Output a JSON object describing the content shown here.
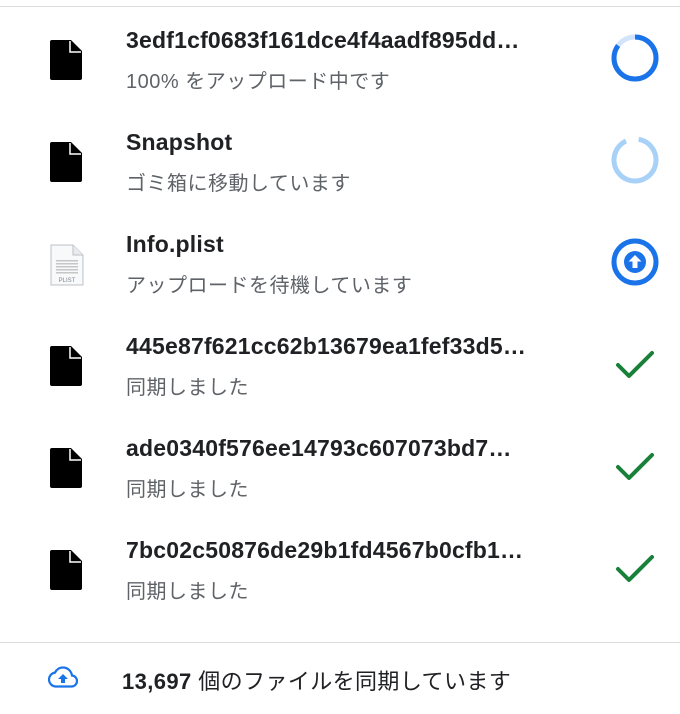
{
  "files": [
    {
      "name": "3edf1cf0683f161dce4f4aadf895dd…",
      "status": "100% をアップロード中です",
      "icon": "document-icon",
      "state_icon": "progress-ring-icon",
      "progress": 0.85,
      "state": "uploading"
    },
    {
      "name": "Snapshot",
      "status": "ゴミ箱に移動しています",
      "icon": "document-icon",
      "state_icon": "progress-ring-light-icon",
      "progress": 0.9,
      "state": "moving-to-trash"
    },
    {
      "name": "Info.plist",
      "status": "アップロードを待機しています",
      "icon": "plist-file-icon",
      "plist_label": "PLIST",
      "state_icon": "upload-pending-icon",
      "state": "waiting"
    },
    {
      "name": "445e87f621cc62b13679ea1fef33d5…",
      "status": "同期しました",
      "icon": "document-icon",
      "state_icon": "checkmark-icon",
      "state": "synced"
    },
    {
      "name": "ade0340f576ee14793c607073bd7…",
      "status": "同期しました",
      "icon": "document-icon",
      "state_icon": "checkmark-icon",
      "state": "synced"
    },
    {
      "name": "7bc02c50876de29b1fd4567b0cfb1…",
      "status": "同期しました",
      "icon": "document-icon",
      "state_icon": "checkmark-icon",
      "state": "synced"
    }
  ],
  "footer": {
    "icon": "cloud-upload-icon",
    "count": "13,697",
    "text": " 個のファイルを同期しています"
  },
  "colors": {
    "accent_blue": "#1a73e8",
    "light_blue": "#a8d1f7",
    "success_green": "#188038",
    "text_primary": "#202124",
    "text_secondary": "#5f6368",
    "divider": "#dadce0"
  }
}
